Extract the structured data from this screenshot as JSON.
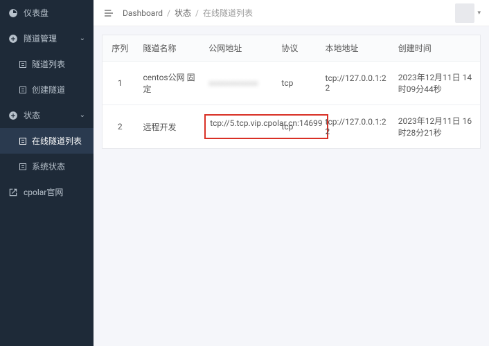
{
  "sidebar": {
    "items": [
      {
        "label": "仪表盘",
        "icon": "dashboard"
      },
      {
        "label": "隧道管理",
        "icon": "plus-circle",
        "expandable": true
      },
      {
        "label": "隧道列表",
        "sub": true
      },
      {
        "label": "创建隧道",
        "sub": true
      },
      {
        "label": "状态",
        "icon": "plus-circle",
        "expandable": true
      },
      {
        "label": "在线隧道列表",
        "sub": true,
        "active": true
      },
      {
        "label": "系统状态",
        "sub": true
      },
      {
        "label": "cpolar官网",
        "icon": "external"
      }
    ]
  },
  "breadcrumb": {
    "item0": "Dashboard",
    "item1": "状态",
    "item2": "在线隧道列表",
    "sep": "/"
  },
  "table": {
    "headers": {
      "seq": "序列",
      "name": "隧道名称",
      "public": "公网地址",
      "proto": "协议",
      "local": "本地地址",
      "time": "创建时间"
    },
    "rows": [
      {
        "seq": "1",
        "name": "centos公网 固定",
        "public_blur": "xxxxxxxxxxxx",
        "proto": "tcp",
        "local": "tcp://127.0.0.1:22",
        "time": "2023年12月11日 14时09分44秒"
      },
      {
        "seq": "2",
        "name": "远程开发",
        "public": "tcp://5.tcp.vip.cpolar.cn:14699",
        "proto": "tcp",
        "local": "tcp://127.0.0.1:22",
        "time": "2023年12月11日 16时28分21秒",
        "highlight": true
      }
    ]
  }
}
